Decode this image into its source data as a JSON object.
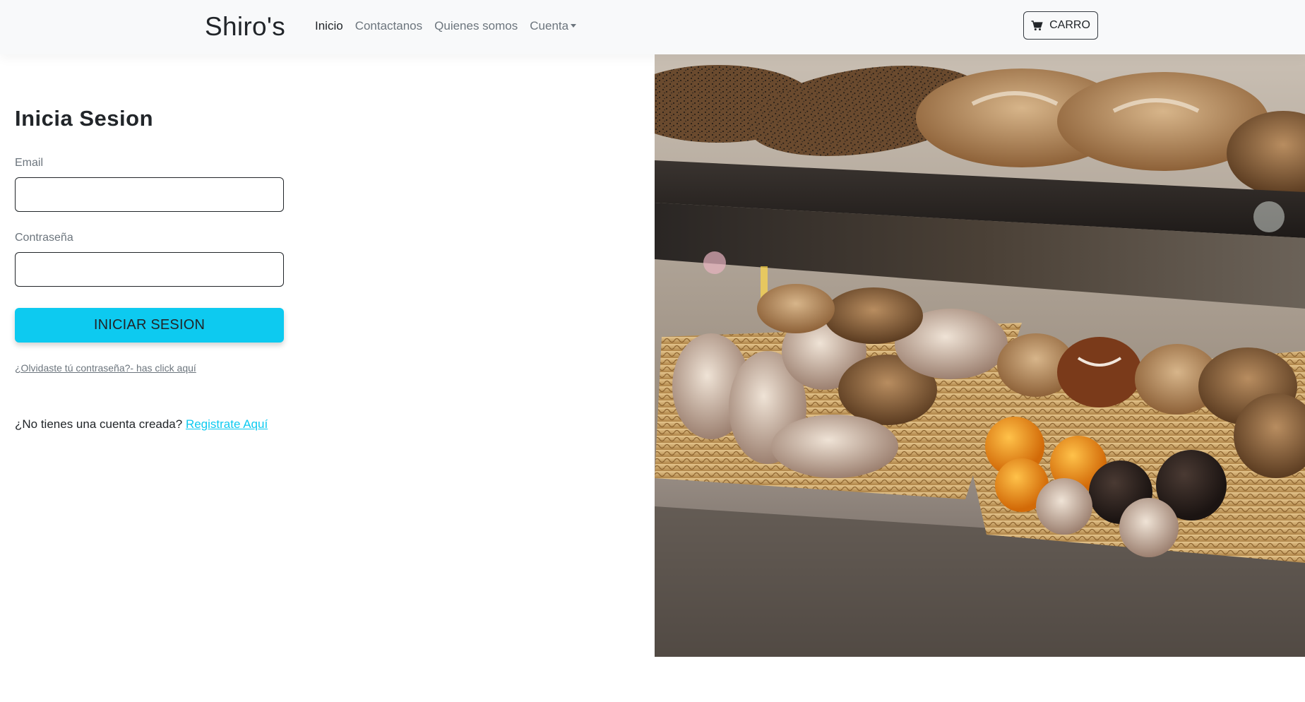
{
  "navbar": {
    "brand": "Shiro's",
    "links": [
      {
        "label": "Inicio",
        "active": true
      },
      {
        "label": "Contactanos",
        "active": false
      },
      {
        "label": "Quienes somos",
        "active": false
      }
    ],
    "account_label": "Cuenta",
    "cart": {
      "label": "CARRO",
      "icon": "cart-icon"
    }
  },
  "login": {
    "title": "Inicia Sesion",
    "email_label": "Email",
    "email_value": "",
    "password_label": "Contraseña",
    "password_value": "",
    "submit_label": "INICIAR SESION",
    "forgot_text": "¿Olvidaste tú contraseña?- has click aquí",
    "no_account_text": "¿No tienes una cuenta creada?",
    "register_link": "Registrate Aquí"
  },
  "hero_image": {
    "subject": "bakery-display-bread-and-pastries"
  },
  "colors": {
    "navbar_bg": "#f8f9fa",
    "accent": "#0dcaf0",
    "text": "#212529",
    "muted": "#6c757d"
  }
}
